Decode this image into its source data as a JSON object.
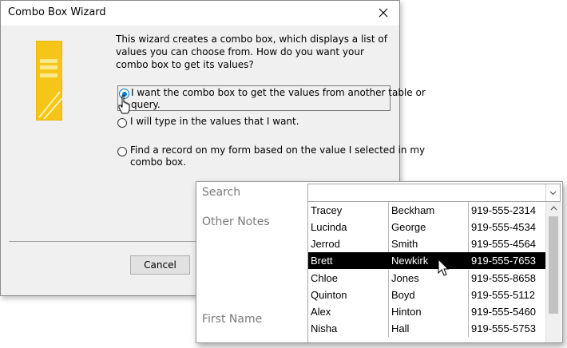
{
  "wizard": {
    "title": "Combo Box Wizard",
    "description": "This wizard creates a combo box, which displays a list of values you can choose from.  How do you want your combo box to get its values?",
    "options": [
      {
        "label_line1": "I want the combo box to get the values from another table or",
        "label_line2": "query.",
        "selected": true
      },
      {
        "label_line1": "I will type in the values that I want.",
        "label_line2": "",
        "selected": false
      },
      {
        "label_line1": "Find a record on my form based on the value I selected in my",
        "label_line2": "combo box.",
        "selected": false
      }
    ],
    "cancel_label": "Cancel"
  },
  "form": {
    "search_label": "Search",
    "notes_label": "Other Notes",
    "first_name_label": "First Name",
    "search_value": "",
    "rows": [
      {
        "first": "Tracey",
        "last": "Beckham",
        "phone": "919-555-2314",
        "selected": false
      },
      {
        "first": "Lucinda",
        "last": "George",
        "phone": "919-555-4534",
        "selected": false
      },
      {
        "first": "Jerrod",
        "last": "Smith",
        "phone": "919-555-4564",
        "selected": false
      },
      {
        "first": "Brett",
        "last": "Newkirk",
        "phone": "919-555-7653",
        "selected": true
      },
      {
        "first": "Chloe",
        "last": "Jones",
        "phone": "919-555-8658",
        "selected": false
      },
      {
        "first": "Quinton",
        "last": "Boyd",
        "phone": "919-555-5112",
        "selected": false
      },
      {
        "first": "Alex",
        "last": "Hinton",
        "phone": "919-555-5460",
        "selected": false
      },
      {
        "first": "Nisha",
        "last": "Hall",
        "phone": "919-555-5753",
        "selected": false
      }
    ]
  },
  "colors": {
    "accent": "#0078d4",
    "selection": "#000000",
    "wizard_art": "#f5c518"
  }
}
